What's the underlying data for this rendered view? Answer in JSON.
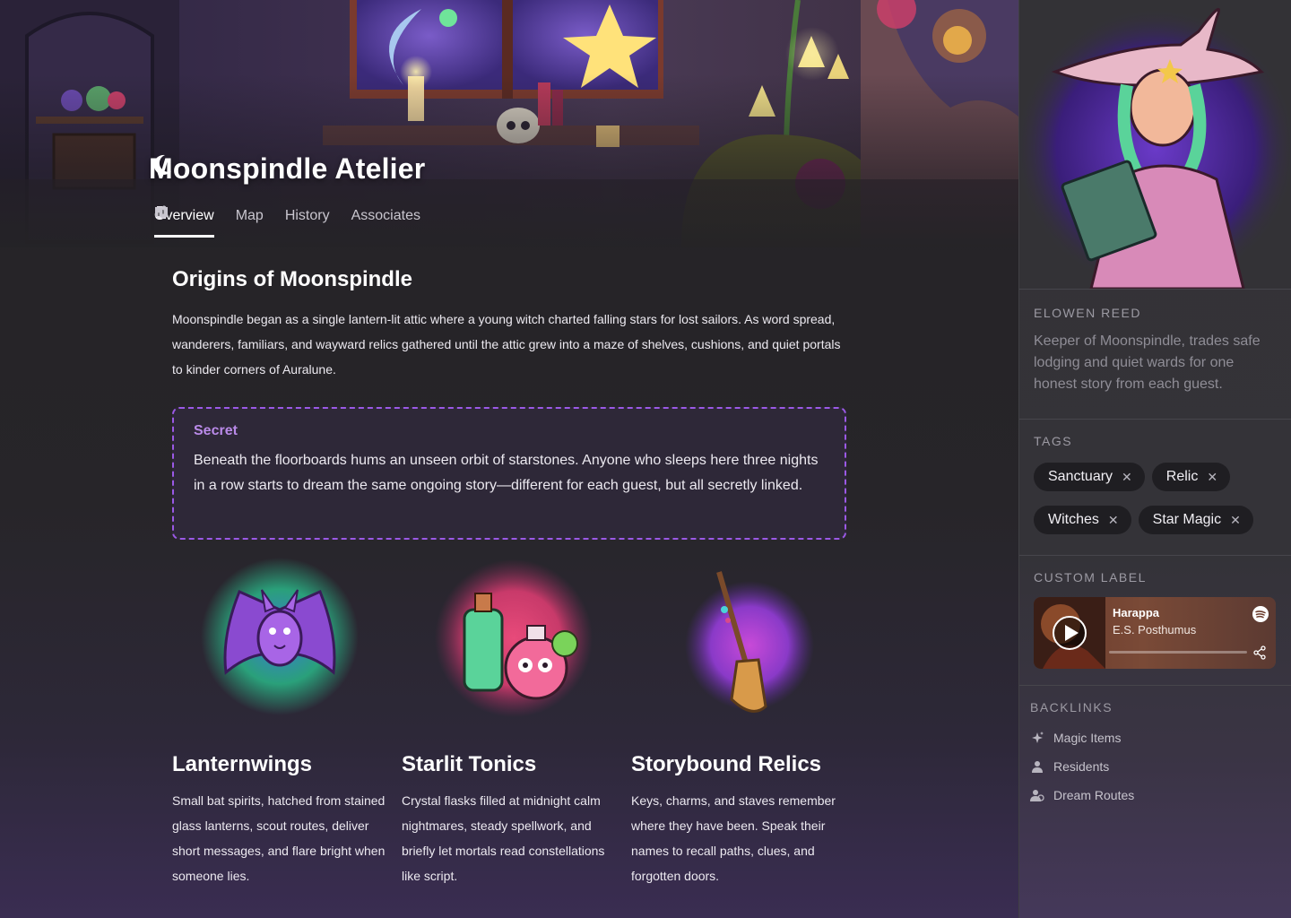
{
  "page": {
    "title": "Moonspindle Atelier",
    "tabs": [
      {
        "label": "Overview",
        "icon": "document-icon",
        "active": true
      },
      {
        "label": "Map",
        "icon": "map-icon",
        "active": false
      },
      {
        "label": "History",
        "icon": "timeline-icon",
        "active": false
      },
      {
        "label": "Associates",
        "icon": "network-icon",
        "active": false
      }
    ]
  },
  "origins": {
    "heading": "Origins of Moonspindle",
    "body": "Moonspindle began as a single lantern-lit attic where a young witch charted falling stars for lost sailors. As word spread, wanderers, familiars, and wayward relics gathered until the attic grew into a maze of shelves, cushions, and quiet portals to kinder corners of Auralune."
  },
  "secret": {
    "label": "Secret",
    "text": "Beneath the floorboards hums an unseen orbit of starstones. Anyone who sleeps here three nights in a row starts to dream the same ongoing story—different for each guest, but all secretly linked."
  },
  "cards": [
    {
      "title": "Lanternwings",
      "text": "Small bat spirits, hatched from stained glass lanterns, scout routes, deliver short messages, and flare bright when someone lies."
    },
    {
      "title": "Starlit Tonics",
      "text": "Crystal flasks filled at midnight calm nightmares, steady spellwork, and briefly let mortals read constellations like script."
    },
    {
      "title": "Storybound Relics",
      "text": "Keys, charms, and staves remember where they have been. Speak their names to recall paths, clues, and forgotten doors."
    }
  ],
  "sidebar": {
    "keeper": {
      "name": "ELOWEN REED",
      "description": "Keeper of Moonspindle, trades safe lodging and quiet wards for one honest story from each guest."
    },
    "tags": {
      "label": "TAGS",
      "items": [
        "Sanctuary",
        "Relic",
        "Witches",
        "Star Magic"
      ],
      "remove_glyph": "✕"
    },
    "custom_label": {
      "label": "CUSTOM LABEL",
      "track": "Harappa",
      "artist": "E.S. Posthumus"
    },
    "backlinks": {
      "label": "BACKLINKS",
      "items": [
        {
          "label": "Magic Items",
          "icon": "sparkle-icon"
        },
        {
          "label": "Residents",
          "icon": "person-icon"
        },
        {
          "label": "Dream Routes",
          "icon": "people-icon"
        }
      ]
    }
  },
  "colors": {
    "accent_purple": "#9b59e6",
    "secret_label": "#b98ae8",
    "tag_bg": "#1f1e22"
  }
}
